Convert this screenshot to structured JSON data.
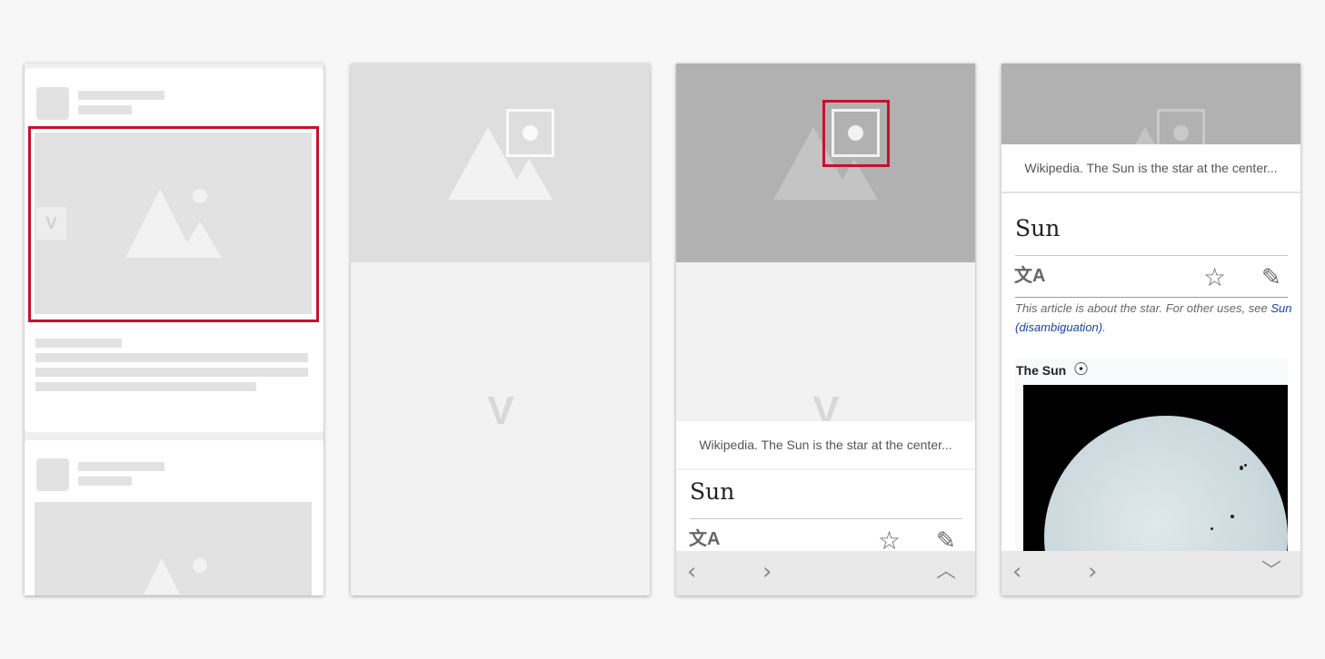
{
  "caption": "Wikipedia. The Sun is the star at the center...",
  "article": {
    "title": "Sun",
    "hatnote_text": "This article is about the star. For other uses, see ",
    "hatnote_link": "Sun (disambiguation)",
    "hatnote_end": ".",
    "infobox_title": "The Sun"
  },
  "icons": {
    "lang": "文A",
    "star": "☆",
    "edit": "✎",
    "back": "‹",
    "forward": "›",
    "up": "︿",
    "down": "﹀",
    "sun_symbol": "☉"
  },
  "colors": {
    "highlight": "#c8102e",
    "link": "#1a3faa",
    "placeholder": "#e2e2e2"
  }
}
